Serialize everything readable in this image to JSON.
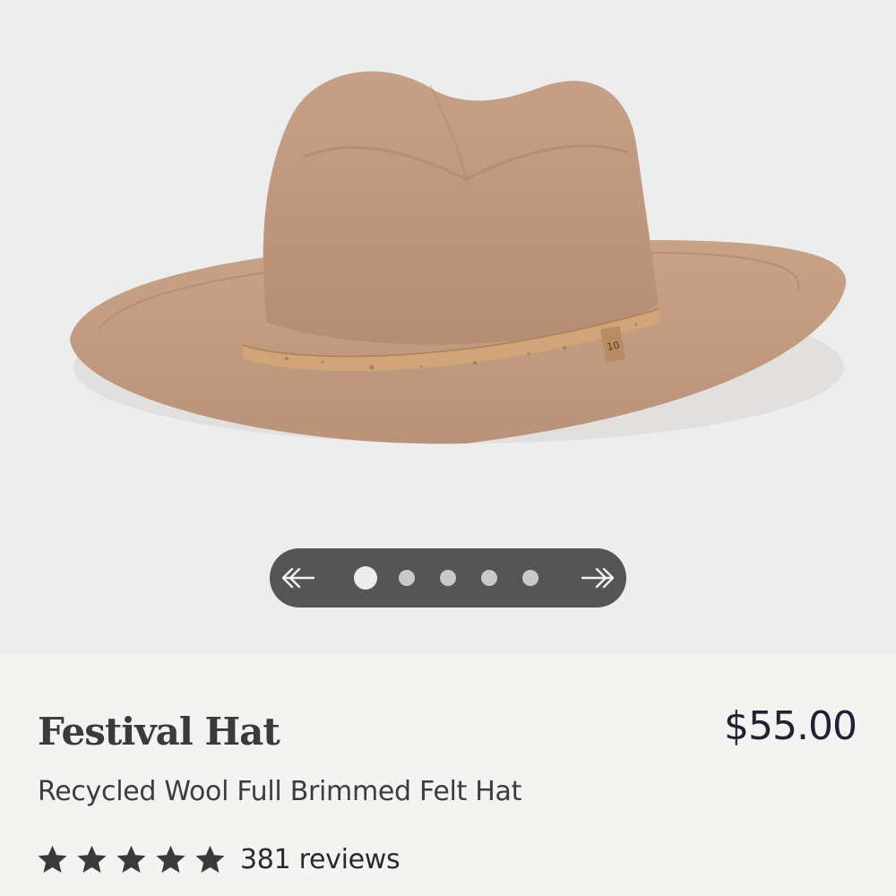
{
  "product": {
    "title": "Festival Hat",
    "price": "$55.00",
    "subtitle": "Recycled Wool Full Brimmed Felt Hat",
    "rating": 5,
    "reviews_label": "381 reviews"
  },
  "gallery": {
    "image_subject": "tan felt wide-brim hat with cork band",
    "slide_count": 5,
    "active_slide": 1,
    "prev_icon": "arrow-left-icon",
    "next_icon": "arrow-right-icon"
  },
  "colors": {
    "hat_felt": "#c29c80",
    "band": "#d1a57a",
    "nav_pill": "#555555",
    "title_text": "#3a3a3a",
    "price_text": "#1f2233"
  }
}
